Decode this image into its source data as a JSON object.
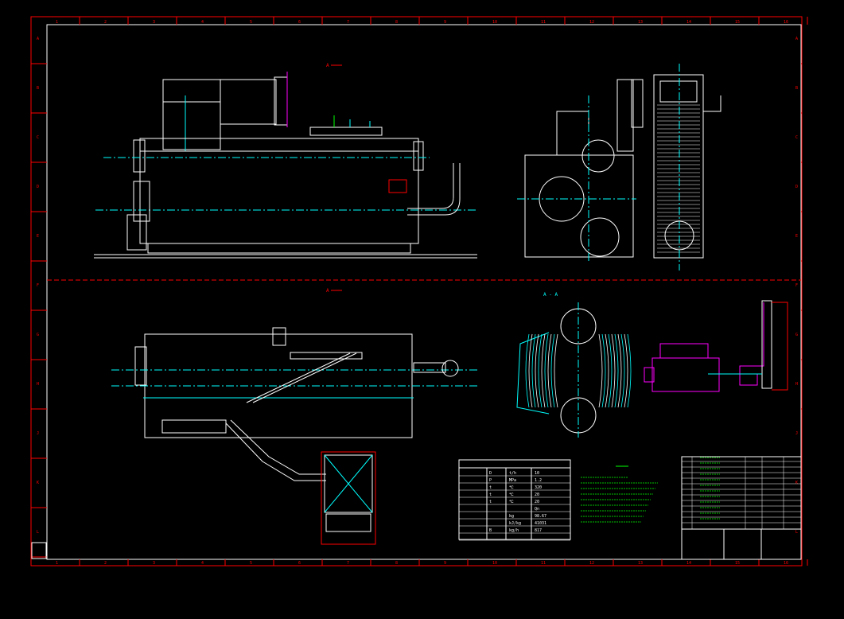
{
  "colors": {
    "background": "#000000",
    "frame": "#ff0000",
    "white": "#ffffff",
    "cyan": "#00ffff",
    "green": "#00ff00",
    "yellow": "#ffff00",
    "magenta": "#ff00ff",
    "blue": "#3a5bff"
  },
  "labels": {
    "front_view": "A",
    "plan_view": "A",
    "section_view": "A - A",
    "side_box_title": "",
    "title_block_company": "",
    "params_rows": [
      [
        "",
        "D",
        "t/h",
        "10"
      ],
      [
        "",
        "P",
        "MPa",
        "1.2"
      ],
      [
        "",
        "t",
        "℃",
        "320"
      ],
      [
        "",
        "t",
        "℃",
        "20"
      ],
      [
        "",
        "t",
        "℃",
        "20"
      ],
      [
        "",
        "",
        "",
        "Qn"
      ],
      [
        "",
        "",
        "kg",
        "98.67"
      ],
      [
        "",
        "",
        "kJ/kg",
        "41031"
      ],
      [
        "",
        "B",
        "kg/h",
        "817"
      ],
      [
        "",
        "",
        "",
        ""
      ]
    ]
  },
  "grid": {
    "top_numbers": [
      "1",
      "2",
      "3",
      "4",
      "5",
      "6",
      "7",
      "8",
      "9",
      "10",
      "11",
      "12",
      "13",
      "14",
      "15",
      "16"
    ],
    "bottom_numbers": [
      "1",
      "2",
      "3",
      "4",
      "5",
      "6",
      "7",
      "8",
      "9",
      "10",
      "11",
      "12",
      "13",
      "14",
      "15",
      "16"
    ],
    "left_letters": [
      "A",
      "B",
      "C",
      "D",
      "E",
      "F",
      "G",
      "H",
      "J",
      "K",
      "L"
    ],
    "right_letters": [
      "A",
      "B",
      "C",
      "D",
      "E",
      "F",
      "G",
      "H",
      "J",
      "K",
      "L"
    ]
  }
}
